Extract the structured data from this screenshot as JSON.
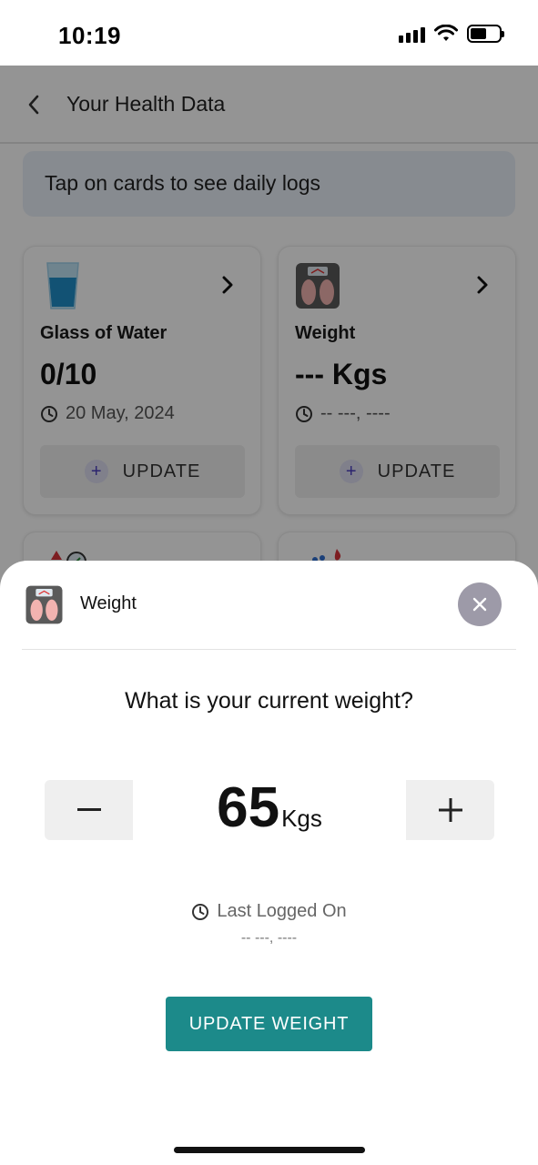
{
  "status_bar": {
    "time": "10:19"
  },
  "header": {
    "title": "Your Health Data"
  },
  "banner": {
    "text": "Tap on cards to see daily logs"
  },
  "cards": [
    {
      "label": "Glass of Water",
      "value": "0/10",
      "date": "20 May, 2024",
      "update_label": "UPDATE",
      "icon": "water-glass-icon"
    },
    {
      "label": "Weight",
      "value": "--- Kgs",
      "date": "-- ---, ----",
      "update_label": "UPDATE",
      "icon": "weight-scale-icon"
    }
  ],
  "sheet": {
    "title": "Weight",
    "question": "What is your current weight?",
    "weight_value": "65",
    "weight_unit": "Kgs",
    "last_logged_label": "Last Logged On",
    "last_logged_date": "-- ---, ----",
    "submit_label": "UPDATE WEIGHT"
  },
  "colors": {
    "accent": "#1c8a8a",
    "close_button": "#9d9aa8",
    "banner": "#e9f0f9"
  }
}
